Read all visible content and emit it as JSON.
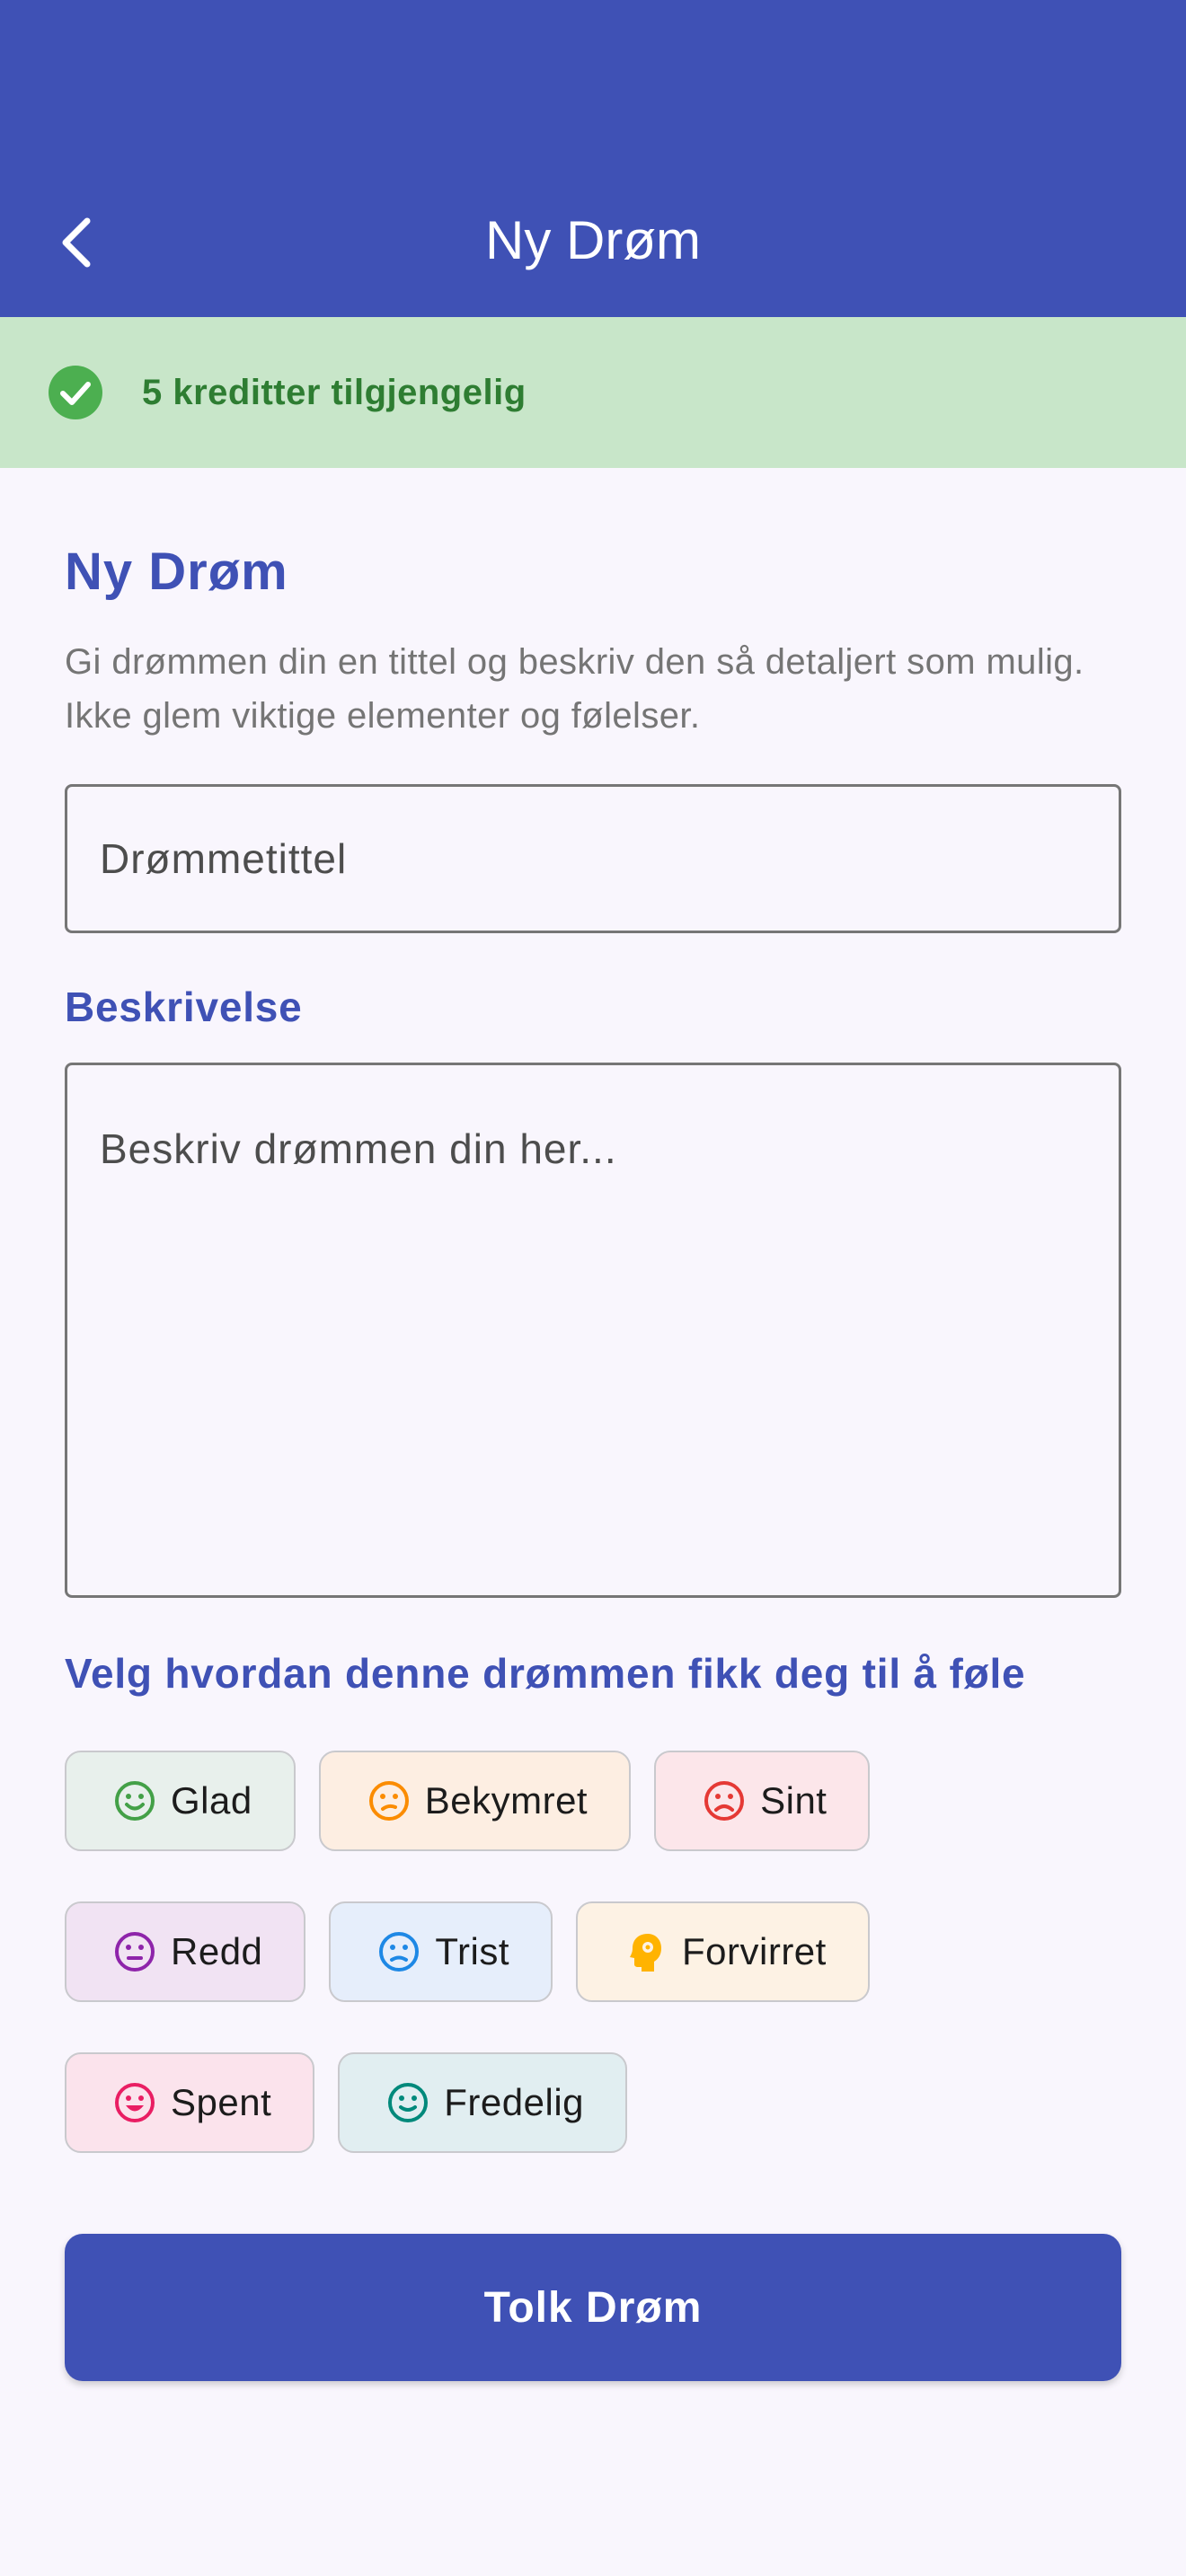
{
  "appbar": {
    "title": "Ny Drøm",
    "back_icon": "chevron-left-icon",
    "color": "#3F51B5"
  },
  "credits": {
    "icon": "check-circle-icon",
    "text": "5 kreditter tilgjengelig",
    "color": "#2E7D32",
    "background": "#C8E6C9"
  },
  "form": {
    "heading": "Ny Drøm",
    "intro": "Gi drømmen din en tittel og beskriv den så detaljert som mulig. Ikke glem viktige elementer og følelser.",
    "title_placeholder": "Drømmetittel",
    "description_label": "Beskrivelse",
    "description_placeholder": "Beskriv drømmen din her...",
    "mood_label": "Velg hvordan denne drømmen fikk deg til å føle"
  },
  "moods": [
    {
      "label": "Glad",
      "icon": "smile-icon",
      "color": "#43A047",
      "bg": "#E8F0EC"
    },
    {
      "label": "Bekymret",
      "icon": "worried-face-icon",
      "color": "#FB8C00",
      "bg": "#FDEEE2"
    },
    {
      "label": "Sint",
      "icon": "frown-icon",
      "color": "#E53935",
      "bg": "#FCE6EA"
    },
    {
      "label": "Redd",
      "icon": "neutral-face-icon",
      "color": "#8E24AA",
      "bg": "#F1E3F3"
    },
    {
      "label": "Trist",
      "icon": "sad-face-icon",
      "color": "#1E88E5",
      "bg": "#E6EEFB"
    },
    {
      "label": "Forvirret",
      "icon": "head-gear-icon",
      "color": "#FFB300",
      "bg": "#FDF2E4"
    },
    {
      "label": "Spent",
      "icon": "excited-face-icon",
      "color": "#E91E63",
      "bg": "#FBE3EC"
    },
    {
      "label": "Fredelig",
      "icon": "calm-face-icon",
      "color": "#00897B",
      "bg": "#E1EEF1"
    }
  ],
  "submit_label": "Tolk Drøm"
}
